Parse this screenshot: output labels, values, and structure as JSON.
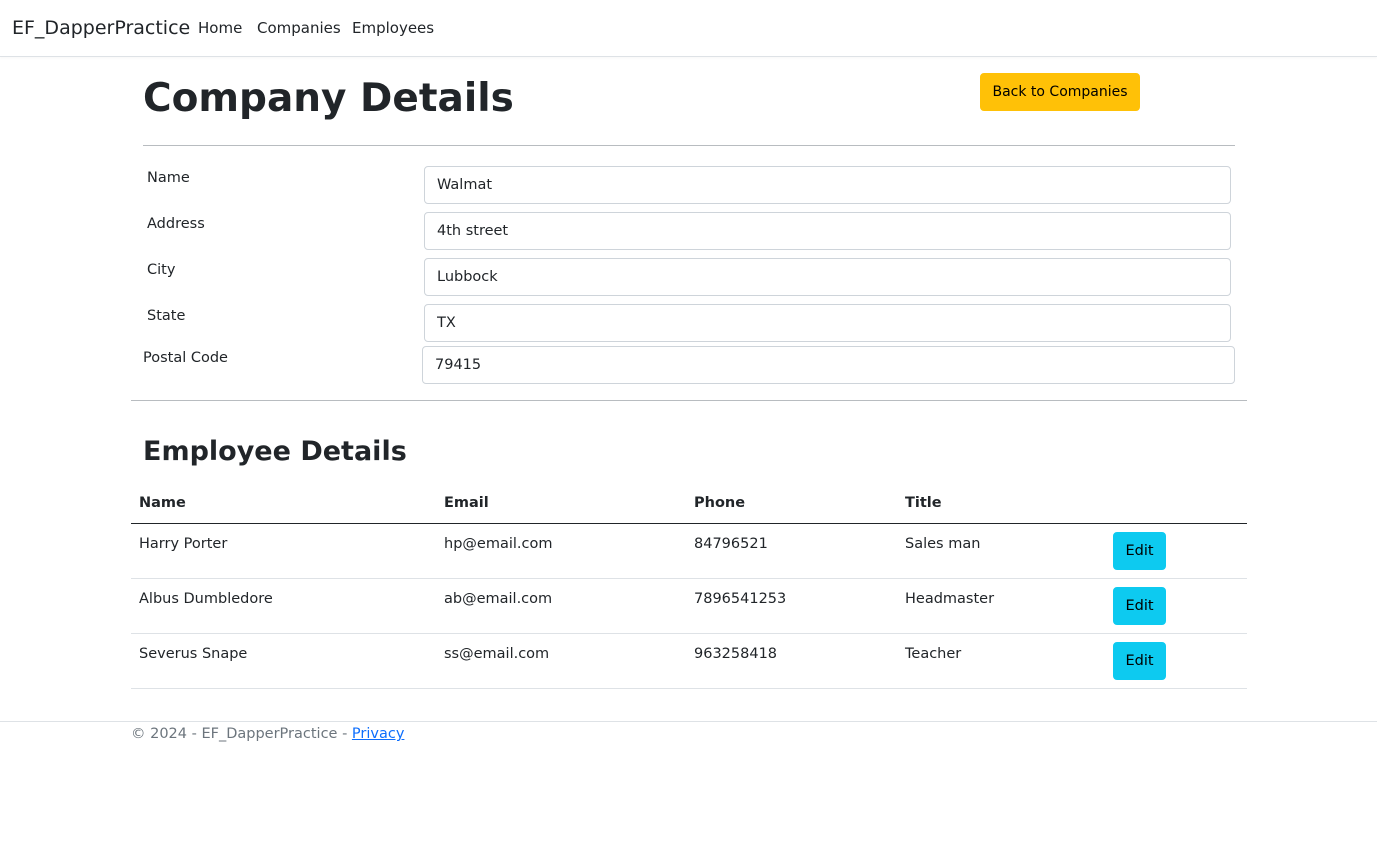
{
  "navbar": {
    "brand": "EF_DapperPractice",
    "links": [
      "Home",
      "Companies",
      "Employees"
    ]
  },
  "company": {
    "title": "Company Details",
    "back_button": "Back to Companies",
    "fields": [
      {
        "label": "Name",
        "value": "Walmat"
      },
      {
        "label": "Address",
        "value": "4th street"
      },
      {
        "label": "City",
        "value": "Lubbock"
      },
      {
        "label": "State",
        "value": "TX"
      },
      {
        "label": "Postal Code",
        "value": "79415"
      }
    ]
  },
  "employees": {
    "title": "Employee Details",
    "columns": [
      "Name",
      "Email",
      "Phone",
      "Title"
    ],
    "rows": [
      {
        "name": "Harry Porter",
        "email": "hp@email.com",
        "phone": "84796521",
        "title": "Sales man",
        "action": "Edit"
      },
      {
        "name": "Albus Dumbledore",
        "email": "ab@email.com",
        "phone": "7896541253",
        "title": "Headmaster",
        "action": "Edit"
      },
      {
        "name": "Severus Snape",
        "email": "ss@email.com",
        "phone": "963258418",
        "title": "Teacher",
        "action": "Edit"
      }
    ]
  },
  "footer": {
    "text": "© 2024 - EF_DapperPractice - ",
    "link": "Privacy"
  },
  "colors": {
    "back_button": "#ffc107",
    "edit_button": "#0dcaf0",
    "link": "#0d6efd"
  }
}
